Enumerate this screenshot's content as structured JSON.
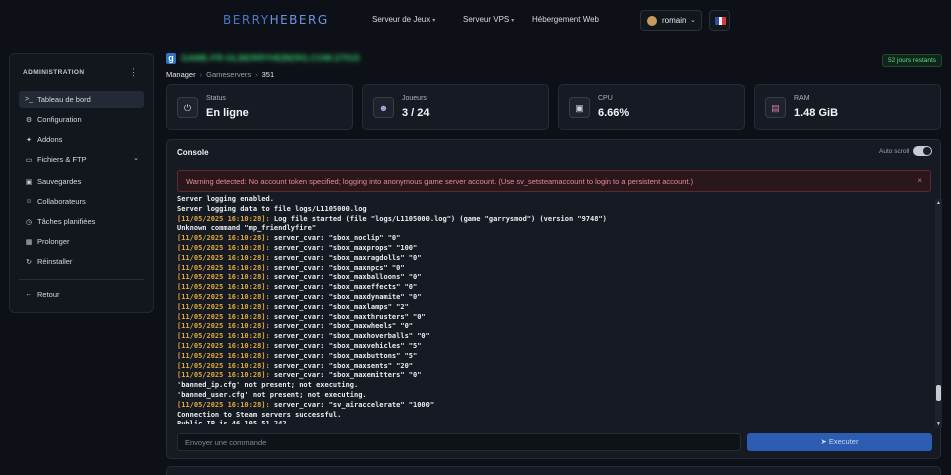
{
  "brand": {
    "part1": "BERRY",
    "part2": "HEBERG"
  },
  "nav": {
    "items": [
      {
        "label": "Serveur de Jeux",
        "dropdown": true
      },
      {
        "label": "Serveur VPS",
        "dropdown": true
      },
      {
        "label": "Hébergement Web",
        "dropdown": false
      }
    ],
    "user": {
      "name": "romain"
    },
    "language_flag": "FR"
  },
  "sidebar": {
    "title": "ADMINISTRATION",
    "items": [
      {
        "label": "Tableau de bord",
        "icon": "terminal-icon",
        "active": true
      },
      {
        "label": "Configuration",
        "icon": "gear-icon"
      },
      {
        "label": "Addons",
        "icon": "puzzle-icon"
      },
      {
        "label": "Fichiers & FTP",
        "icon": "folder-icon",
        "expandable": true
      },
      {
        "label": "Sauvegardes",
        "icon": "archive-icon"
      },
      {
        "label": "Collaborateurs",
        "icon": "users-icon"
      },
      {
        "label": "Tâches planifiées",
        "icon": "clock-icon"
      },
      {
        "label": "Prolonger",
        "icon": "calendar-icon"
      },
      {
        "label": "Réinstaller",
        "icon": "refresh-icon"
      }
    ],
    "back_label": "Retour"
  },
  "server": {
    "game_badge": "g",
    "name": "GAME-FR-GLBERRYHEBERG.COM:27015",
    "days_left": "52 jours restants"
  },
  "breadcrumb": [
    "Manager",
    "Gameservers",
    "351"
  ],
  "stats": [
    {
      "label": "Status",
      "value": "En ligne",
      "icon": "power-icon"
    },
    {
      "label": "Joueurs",
      "value": "3 / 24",
      "icon": "users-icon"
    },
    {
      "label": "CPU",
      "value": "6.66%",
      "icon": "cpu-icon"
    },
    {
      "label": "RAM",
      "value": "1.48 GiB",
      "icon": "memory-icon"
    }
  ],
  "console": {
    "title": "Console",
    "autoscroll_label": "Auto scroll",
    "autoscroll_on": true,
    "warning": "Warning detected: No account token specified; logging into anonymous game server account. (Use sv_setsteamaccount to login to a persistent account.)",
    "lines": [
      {
        "ts": "",
        "text": "Server logging enabled."
      },
      {
        "ts": "",
        "text": "Server logging data to file logs/L1105000.log"
      },
      {
        "ts": "[11/05/2025 16:10:28]:",
        "text": " Log file started (file \"logs/L1105000.log\") (game \"garrysmod\") (version \"9748\")"
      },
      {
        "ts": "",
        "text": "Unknown command \"mp_friendlyfire\""
      },
      {
        "ts": "[11/05/2025 16:10:28]:",
        "text": " server_cvar: \"sbox_noclip\" \"0\""
      },
      {
        "ts": "[11/05/2025 16:10:28]:",
        "text": " server_cvar: \"sbox_maxprops\" \"100\""
      },
      {
        "ts": "[11/05/2025 16:10:28]:",
        "text": " server_cvar: \"sbox_maxragdolls\" \"0\""
      },
      {
        "ts": "[11/05/2025 16:10:28]:",
        "text": " server_cvar: \"sbox_maxnpcs\" \"0\""
      },
      {
        "ts": "[11/05/2025 16:10:28]:",
        "text": " server_cvar: \"sbox_maxballoons\" \"0\""
      },
      {
        "ts": "[11/05/2025 16:10:28]:",
        "text": " server_cvar: \"sbox_maxeffects\" \"0\""
      },
      {
        "ts": "[11/05/2025 16:10:28]:",
        "text": " server_cvar: \"sbox_maxdynamite\" \"0\""
      },
      {
        "ts": "[11/05/2025 16:10:28]:",
        "text": " server_cvar: \"sbox_maxlamps\" \"2\""
      },
      {
        "ts": "[11/05/2025 16:10:28]:",
        "text": " server_cvar: \"sbox_maxthrusters\" \"0\""
      },
      {
        "ts": "[11/05/2025 16:10:28]:",
        "text": " server_cvar: \"sbox_maxwheels\" \"0\""
      },
      {
        "ts": "[11/05/2025 16:10:28]:",
        "text": " server_cvar: \"sbox_maxhoverballs\" \"0\""
      },
      {
        "ts": "[11/05/2025 16:10:28]:",
        "text": " server_cvar: \"sbox_maxvehicles\" \"5\""
      },
      {
        "ts": "[11/05/2025 16:10:28]:",
        "text": " server_cvar: \"sbox_maxbuttons\" \"5\""
      },
      {
        "ts": "[11/05/2025 16:10:28]:",
        "text": " server_cvar: \"sbox_maxsents\" \"20\""
      },
      {
        "ts": "[11/05/2025 16:10:28]:",
        "text": " server_cvar: \"sbox_maxemitters\" \"0\""
      },
      {
        "ts": "",
        "text": "'banned_ip.cfg' not present; not executing."
      },
      {
        "ts": "",
        "text": "'banned_user.cfg' not present; not executing."
      },
      {
        "ts": "[11/05/2025 16:10:28]:",
        "text": " server_cvar: \"sv_airaccelerate\" \"1000\""
      },
      {
        "ts": "",
        "text": "Connection to Steam servers successful."
      },
      {
        "ts": "",
        "text": "Public IP is 46.105.51.242."
      }
    ],
    "input_placeholder": "Envoyer une commande",
    "execute_label": "Executer"
  },
  "colors": {
    "accent": "#2c5db3",
    "success": "#5bdc8f",
    "timestamp": "#e0a838",
    "warning_text": "#ea8a94"
  }
}
